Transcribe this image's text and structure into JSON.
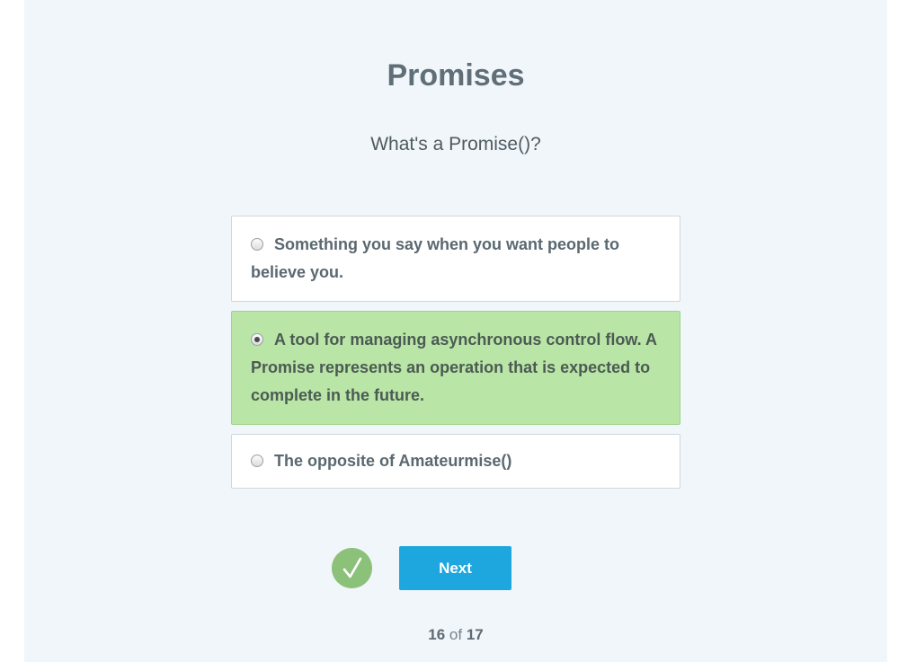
{
  "quiz": {
    "title": "Promises",
    "question": "What's a Promise()?",
    "options": [
      {
        "label": "Something you say when you want people to believe you.",
        "selected": false
      },
      {
        "label": "A tool for managing asynchronous control flow. A Promise represents an operation that is expected to complete in the future.",
        "selected": true
      },
      {
        "label": "The opposite of Amateurmise()",
        "selected": false
      }
    ],
    "status_icon": "checkmark-icon",
    "next_label": "Next",
    "progress": {
      "current": "16",
      "separator": "of",
      "total": "17"
    }
  },
  "colors": {
    "background": "#f1f6fa",
    "selected_option": "#b9e6a6",
    "next_button": "#1ea7de",
    "check_badge": "#8cc17a",
    "title_text": "#5f6e77"
  }
}
